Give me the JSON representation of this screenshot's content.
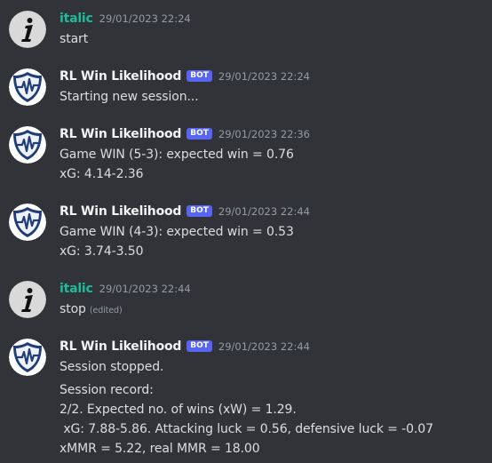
{
  "messages": [
    {
      "author": "italic",
      "is_bot": false,
      "avatar_icon": "italic-i-avatar-icon",
      "timestamp": "29/01/2023 22:24",
      "lines": [
        "start"
      ],
      "edited": ""
    },
    {
      "author": "RL Win Likelihood",
      "is_bot": true,
      "bot_badge": "BOT",
      "avatar_icon": "shield-heartbeat-avatar-icon",
      "timestamp": "29/01/2023 22:24",
      "lines": [
        "Starting new session..."
      ]
    },
    {
      "author": "RL Win Likelihood",
      "is_bot": true,
      "bot_badge": "BOT",
      "avatar_icon": "shield-heartbeat-avatar-icon",
      "timestamp": "29/01/2023 22:36",
      "lines": [
        "Game WIN (5-3): expected win = 0.76",
        "xG: 4.14-2.36"
      ]
    },
    {
      "author": "RL Win Likelihood",
      "is_bot": true,
      "bot_badge": "BOT",
      "avatar_icon": "shield-heartbeat-avatar-icon",
      "timestamp": "29/01/2023 22:44",
      "lines": [
        "Game WIN (4-3): expected win = 0.53",
        "xG: 3.74-3.50"
      ]
    },
    {
      "author": "italic",
      "is_bot": false,
      "avatar_icon": "italic-i-avatar-icon",
      "timestamp": "29/01/2023 22:44",
      "lines": [
        "stop"
      ],
      "edited": "(edited)"
    },
    {
      "author": "RL Win Likelihood",
      "is_bot": true,
      "bot_badge": "BOT",
      "avatar_icon": "shield-heartbeat-avatar-icon",
      "timestamp": "29/01/2023 22:44",
      "lines": [
        "Session stopped.",
        "Session record:",
        "2/2. Expected no. of wins (xW) = 1.29.",
        " xG: 7.88-5.86. Attacking luck = 0.56, defensive luck = -0.07",
        "xMMR = 5.22, real MMR = 18.00"
      ]
    }
  ],
  "colors": {
    "background": "#313338",
    "user_name": "#1abc9c",
    "bot_name": "#f2f3f5",
    "bot_badge": "#5865f2",
    "timestamp": "#949ba4",
    "message_text": "#dbdee1"
  }
}
